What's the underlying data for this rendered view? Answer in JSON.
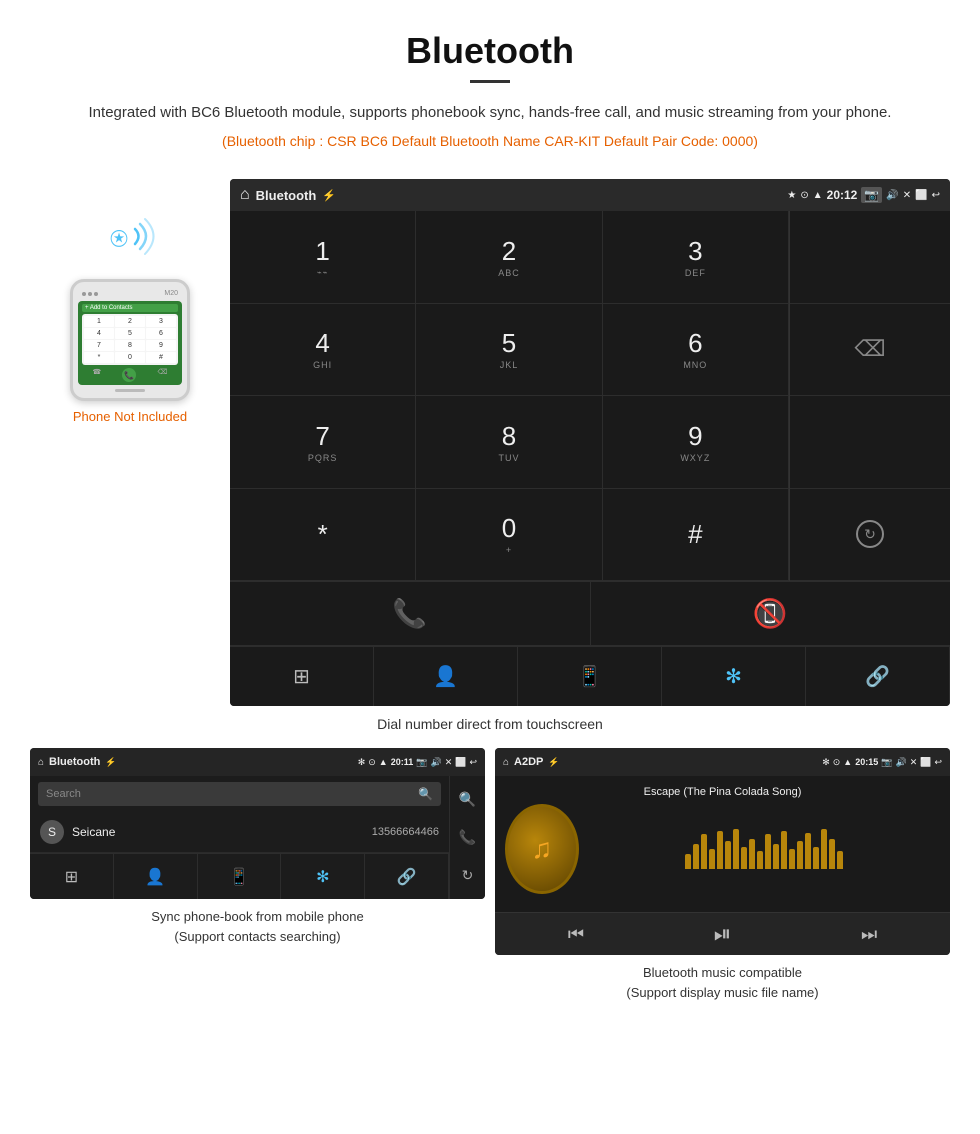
{
  "header": {
    "title": "Bluetooth",
    "description": "Integrated with BC6 Bluetooth module, supports phonebook sync, hands-free call, and music streaming from your phone.",
    "specs": "(Bluetooth chip : CSR BC6    Default Bluetooth Name CAR-KIT    Default Pair Code: 0000)"
  },
  "phone_label": "Phone Not Included",
  "dial_screen": {
    "app_title": "Bluetooth",
    "time": "20:12",
    "keys": [
      {
        "num": "1",
        "sub": ""
      },
      {
        "num": "2",
        "sub": "ABC"
      },
      {
        "num": "3",
        "sub": "DEF"
      },
      {
        "num": "4",
        "sub": "GHI"
      },
      {
        "num": "5",
        "sub": "JKL"
      },
      {
        "num": "6",
        "sub": "MNO"
      },
      {
        "num": "7",
        "sub": "PQRS"
      },
      {
        "num": "8",
        "sub": "TUV"
      },
      {
        "num": "9",
        "sub": "WXYZ"
      },
      {
        "num": "*",
        "sub": ""
      },
      {
        "num": "0",
        "sub": "+"
      },
      {
        "num": "#",
        "sub": ""
      }
    ]
  },
  "dial_caption": "Dial number direct from touchscreen",
  "phonebook_screen": {
    "app_title": "Bluetooth",
    "time": "20:11",
    "search_placeholder": "Search",
    "contacts": [
      {
        "initial": "S",
        "name": "Seicane",
        "phone": "13566664466"
      }
    ]
  },
  "phonebook_caption_line1": "Sync phone-book from mobile phone",
  "phonebook_caption_line2": "(Support contacts searching)",
  "music_screen": {
    "app_title": "A2DP",
    "time": "20:15",
    "song_title": "Escape (The Pina Colada Song)"
  },
  "music_caption_line1": "Bluetooth music compatible",
  "music_caption_line2": "(Support display music file name)",
  "visualizer_bars": [
    15,
    25,
    35,
    20,
    38,
    28,
    40,
    22,
    30,
    18,
    35,
    25,
    38,
    20,
    28,
    36,
    22,
    40,
    30,
    18
  ]
}
